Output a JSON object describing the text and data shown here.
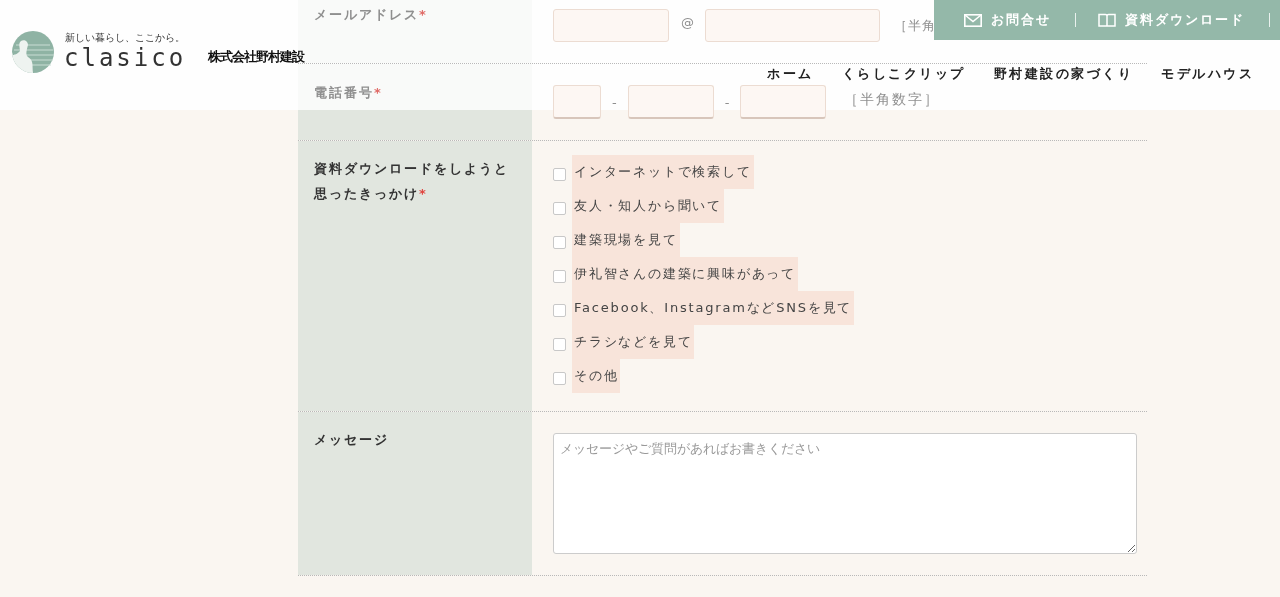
{
  "header": {
    "tagline": "新しい暮らし、ここから。",
    "brand": "clasico",
    "company": "株式会社野村建設",
    "top_links": [
      {
        "label": "お問合せ"
      },
      {
        "label": "資料ダウンロード"
      }
    ],
    "nav": [
      "ホーム",
      "くらしこクリップ",
      "野村建設の家づくり",
      "モデルハウス"
    ]
  },
  "form": {
    "rows": [
      {
        "kind": "email",
        "label": "メールアドレス",
        "required_mark": "*",
        "separator": "@",
        "note": "［半角"
      },
      {
        "kind": "phone",
        "label": "電話番号",
        "required_mark": "*",
        "separators": [
          "-",
          "-"
        ],
        "note": "［半角数字］"
      },
      {
        "kind": "checkboxes",
        "label": "資料ダウンロードをしようと思ったきっかけ",
        "required_mark": "*",
        "options": [
          {
            "label": "インターネットで検索して",
            "checked": false
          },
          {
            "label": "友人・知人から聞いて",
            "checked": false
          },
          {
            "label": "建築現場を見て",
            "checked": false
          },
          {
            "label": "伊礼智さんの建築に興味があって",
            "checked": false
          },
          {
            "label": "Facebook、InstagramなどSNSを見て",
            "checked": false
          },
          {
            "label": "チラシなどを見て",
            "checked": false
          },
          {
            "label": "その他",
            "checked": false
          }
        ]
      },
      {
        "kind": "textarea",
        "label": "メッセージ",
        "placeholder": "メッセージやご質問があればお書きください"
      }
    ]
  }
}
